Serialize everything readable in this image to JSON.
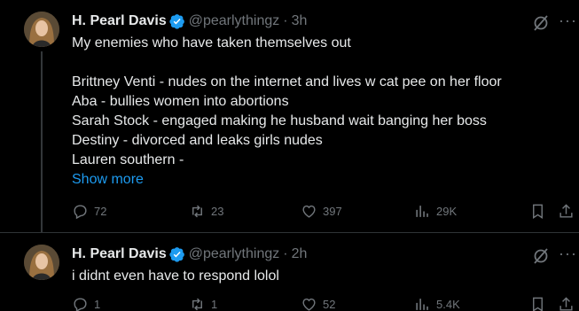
{
  "tweets": [
    {
      "name": "H. Pearl Davis",
      "handle": "@pearlythingz",
      "separator": "·",
      "time": "3h",
      "lines": [
        "My enemies who have taken themselves out",
        "",
        "Brittney Venti - nudes on the internet and lives w cat pee on her floor",
        "Aba - bullies women into abortions",
        "Sarah Stock - engaged making he husband wait banging her boss",
        "Destiny - divorced and leaks girls nudes",
        "Lauren southern -"
      ],
      "show_more": "Show more",
      "replies": "72",
      "reposts": "23",
      "likes": "397",
      "views": "29K"
    },
    {
      "name": "H. Pearl Davis",
      "handle": "@pearlythingz",
      "separator": "·",
      "time": "2h",
      "lines": [
        "i didnt even have to respond lolol"
      ],
      "replies": "1",
      "reposts": "1",
      "likes": "52",
      "views": "5.4K"
    }
  ],
  "more_menu_glyph": "···",
  "colors": {
    "accent": "#1d9bf0",
    "muted": "#71767b",
    "text": "#e7e9ea",
    "background": "#000000"
  }
}
